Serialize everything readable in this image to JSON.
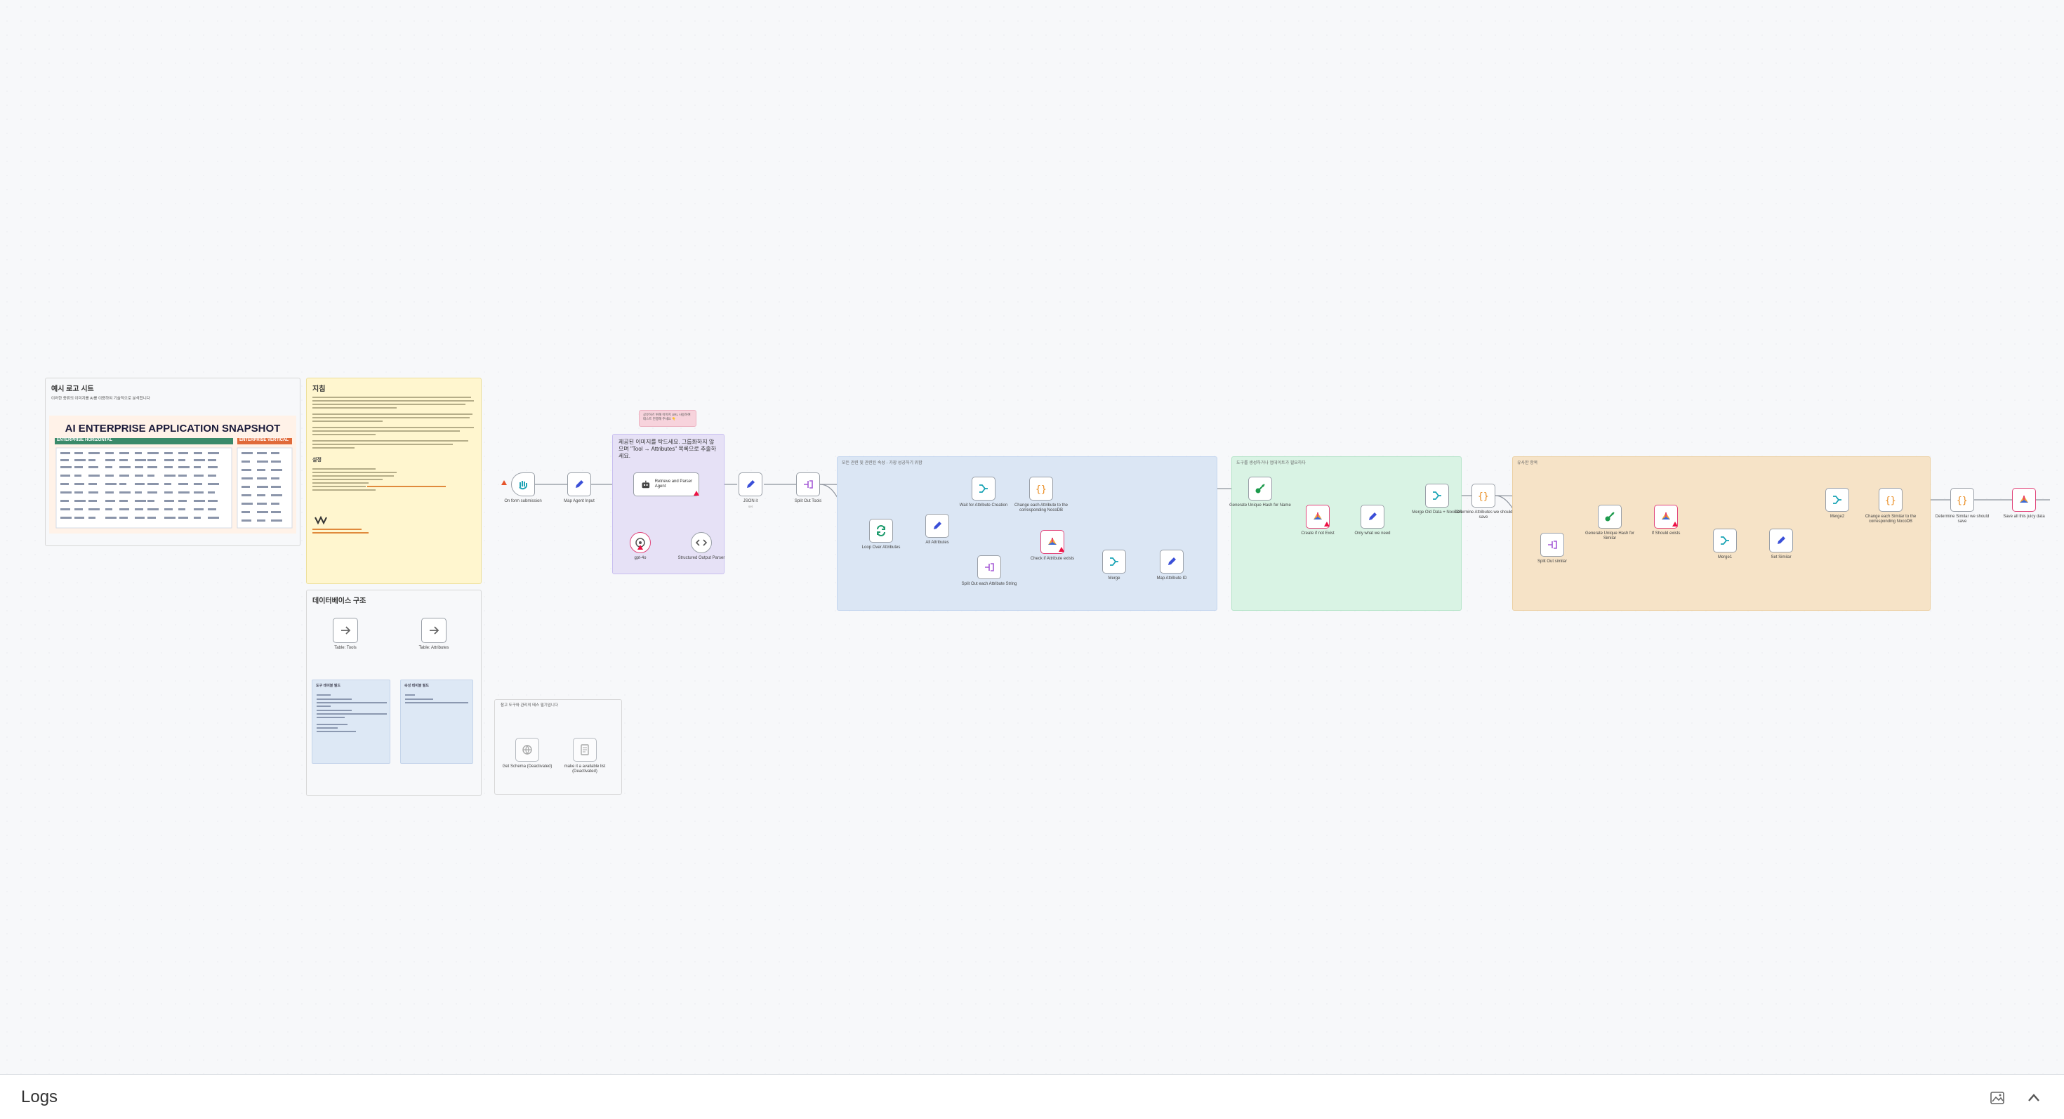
{
  "canvas": {
    "sticky_example": {
      "title": "예시 로고 시트",
      "text": "이러한 종류의 이미지를 AI를 이용하여 기술적으로 분석합니다",
      "snapshot_title": "AI ENTERPRISE APPLICATION SNAPSHOT",
      "snapshot_left_label": "ENTERPRISE HORIZONTAL",
      "snapshot_right_label": "ENTERPRISE VERTICAL"
    },
    "sticky_guide": {
      "title": "지침",
      "section_label": "설정"
    },
    "sticky_data": {
      "title": "데이터베이스 구조",
      "table_tools": "Table: Tools",
      "table_attributes": "Table: Attributes",
      "tools_card_title": "도구 테이블 필드",
      "attributes_card_title": "속성 테이블 필드"
    },
    "sticky_small_note": {
      "text": "공유하기 위해 이미지 URL 사용하여 테스트 진행해 주세요 👇"
    },
    "sticky_purple": {
      "title": "제공된 이미지를 탁드세요. 그룹화하지 않으며 \"Tool → Attributes\" 목록으로 추출하세요."
    },
    "sticky_test": {
      "text": "참고 도구와 관리의 테스 필기입니다"
    },
    "groups": {
      "blue": "모든 관련 및 관련된 속성 - 가장 성공하기 위함",
      "green": "도구를 생성하거나 업데이트가 필요하다",
      "orange": "유사한 항목"
    },
    "nodes": {
      "form": "On form submission",
      "map_agent": "Map Agent Input",
      "retrieve_agent": "Retrieve and Parser Agent",
      "gpt": "gpt-4o",
      "structured": "Structured Output Parser",
      "json_it": "JSON it",
      "json_it_sub": "set",
      "split_out_tools": "Split Out Tools",
      "loop_attr": "Loop Over Attributes",
      "all_attr": "All Attributes",
      "wait_attr": "Wait for Attribute Creation",
      "change_each": "Change each Attribute to the corresponding NocoDB",
      "check_attr": "Check if Attribute exists",
      "split_out_each": "Split Out each Attribute String",
      "merge": "Merge",
      "map_attr": "Map Attribute ID",
      "gen_hash": "Generate Unique Hash for Name",
      "create_if": "Create if not Exist",
      "only_new": "Only what we need",
      "merge_old": "Merge Old Data + NocoDB",
      "determine_attr": "Determine Attributes we should save",
      "gen_hash2": "Generate Unique Hash for Similar",
      "if_should": "If Should exists",
      "split_similar": "Split Out similar",
      "merge1": "Merge1",
      "set_similar": "Set Similar",
      "merge2": "Merge2",
      "change_similar": "Change each Similar to the corresponding NocoDB",
      "determine_similar": "Determine Similar we should save",
      "save": "Save all this juicy data",
      "get_schema": "Get Schema (Deactivated)",
      "make_available": "make it a available list (Deactivated)"
    }
  },
  "logs": {
    "title": "Logs"
  },
  "icons": {
    "toggle": "image-toggle-icon",
    "chevron": "chevron-up-icon"
  }
}
